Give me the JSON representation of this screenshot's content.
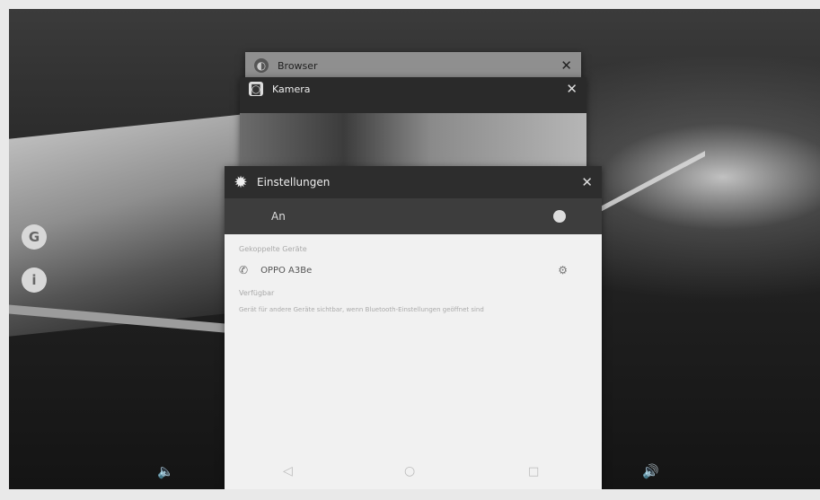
{
  "recents": {
    "browser": {
      "title": "Browser",
      "icon": "browser-icon",
      "close": "✕"
    },
    "kamera": {
      "title": "Kamera",
      "icon": "camera-icon",
      "close": "✕"
    },
    "settings": {
      "title": "Einstellungen",
      "icon": "gear-icon",
      "close": "✕",
      "toggle_label": "An",
      "section_paired": "Gekoppelte Geräte",
      "device_name": "OPPO A3Be",
      "section_other": "Verfügbar",
      "description": "Gerät für andere Geräte sichtbar, wenn Bluetooth-Einstellungen geöffnet sind"
    }
  },
  "side_buttons": {
    "g": "G",
    "i": "i"
  },
  "nav": {
    "vol_down": "🔈",
    "back": "◁",
    "home": "○",
    "recent": "□",
    "vol_up": "🔊"
  }
}
